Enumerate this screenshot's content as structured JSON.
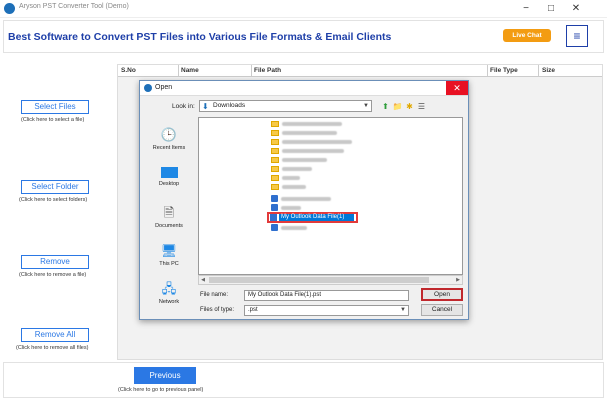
{
  "window": {
    "title": "Aryson PST Converter Tool (Demo)",
    "minimize": "−",
    "maximize": "□",
    "close": "✕"
  },
  "header": {
    "title": "Best Software to Convert PST Files into Various File Formats & Email Clients",
    "live_chat": "Live Chat",
    "menu_icon": "≡"
  },
  "sidebar": {
    "buttons": [
      {
        "label": "Select Files",
        "hint": "(Click here to select a file)"
      },
      {
        "label": "Select Folder",
        "hint": "(Click here to select folders)"
      },
      {
        "label": "Remove",
        "hint": "(Click here to remove a file)"
      },
      {
        "label": "Remove All",
        "hint": "(Click here to remove all files)"
      }
    ]
  },
  "table": {
    "columns": [
      "S.No",
      "Name",
      "File Path",
      "File Type",
      "Size"
    ]
  },
  "footer": {
    "previous_label": "Previous",
    "previous_hint": "(Click here to go to previous panel)"
  },
  "dialog": {
    "title": "Open",
    "look_in_label": "Look in:",
    "look_in_value": "Downloads",
    "places": [
      "Recent Items",
      "Desktop",
      "Documents",
      "This PC",
      "Network"
    ],
    "selected_file": "My Outlook Data File(1)",
    "file_name_label": "File name:",
    "file_name_value": "My Outlook Data File(1).pst",
    "file_type_label": "Files of type:",
    "file_type_value": ".pst",
    "open_label": "Open",
    "cancel_label": "Cancel"
  },
  "colors": {
    "brand_blue": "#1e3fa8",
    "button_blue": "#2b78e4",
    "live_chat_orange": "#f39c12",
    "highlight_red": "#e23a3a"
  }
}
